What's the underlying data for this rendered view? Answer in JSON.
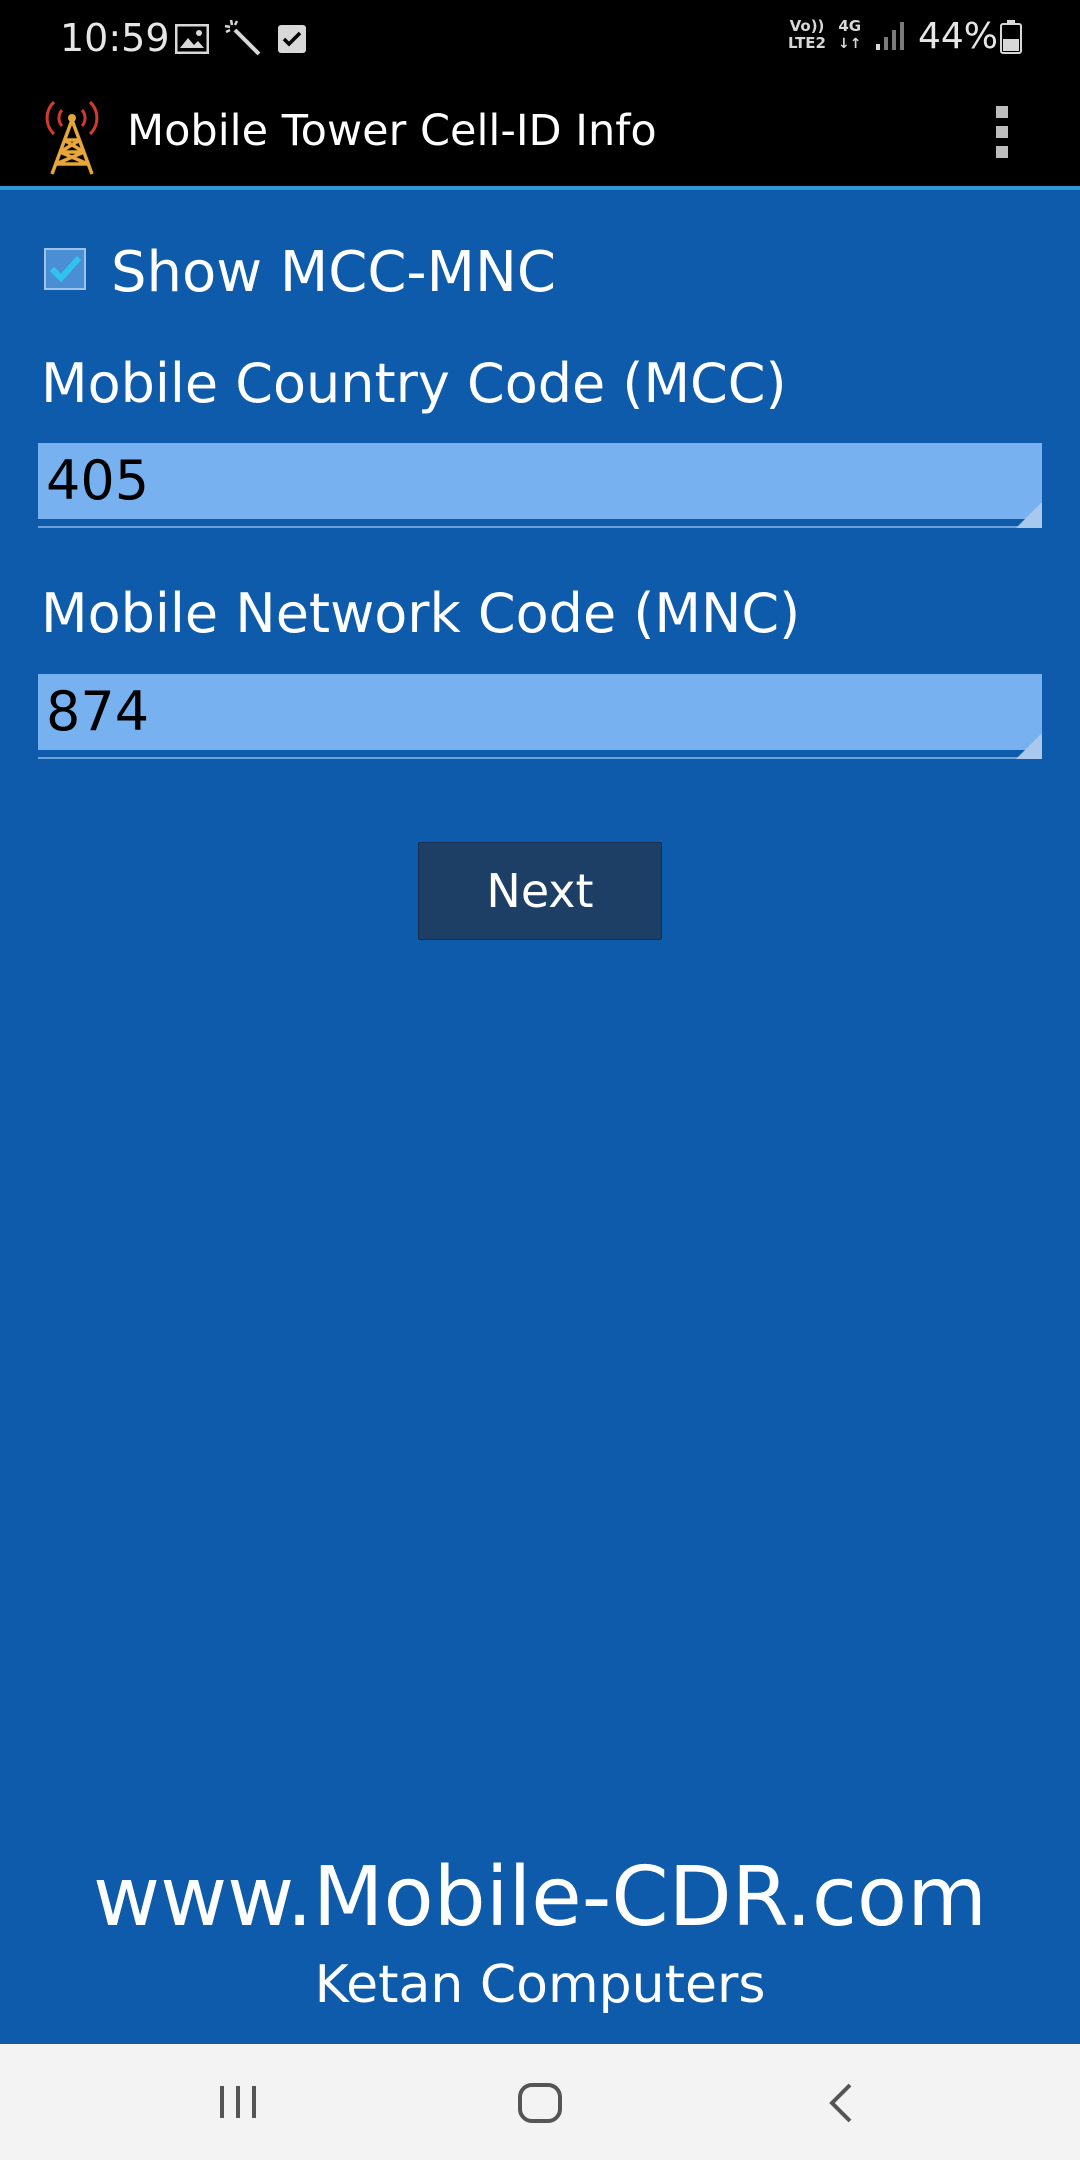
{
  "status_bar": {
    "time": "10:59",
    "network_line1": "Vo))",
    "network_line2": "LTE2",
    "network_type": "4G",
    "battery_percent": "44%",
    "icons": [
      "gallery-icon",
      "magic-wand-icon",
      "checkbox-notification-icon",
      "volte-icon",
      "4g-data-icon",
      "signal-icon",
      "battery-icon"
    ]
  },
  "app_bar": {
    "title": "Mobile Tower Cell-ID Info",
    "logo_icon": "tower-icon",
    "menu_icon": "overflow-menu-icon"
  },
  "form": {
    "show_mcc_mnc": {
      "label": "Show MCC-MNC",
      "checked": true
    },
    "mcc": {
      "label": "Mobile Country Code (MCC)",
      "value": "405"
    },
    "mnc": {
      "label": "Mobile Network Code (MNC)",
      "value": "874"
    },
    "next_label": "Next"
  },
  "footer": {
    "url": "www.Mobile-CDR.com",
    "company": "Ketan Computers"
  },
  "nav_bar": {
    "icons": [
      "recents-icon",
      "home-icon",
      "back-icon"
    ]
  },
  "colors": {
    "background": "#0e5aab",
    "field_background": "#78b1ef",
    "button": "#1d3f66",
    "accent_line": "#2b97d6"
  }
}
